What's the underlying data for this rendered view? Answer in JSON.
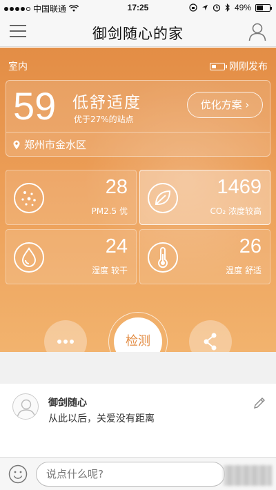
{
  "status_bar": {
    "carrier": "中国联通",
    "time": "17:25",
    "battery_text": "49%",
    "battery_level": 0.49
  },
  "nav": {
    "title": "御剑随心的家",
    "menu_icon": "hamburger-menu-icon",
    "user_icon": "user-profile-icon"
  },
  "main": {
    "section_label": "室内",
    "publish_status": "刚刚发布",
    "score": "59",
    "comfort_level": "低舒适度",
    "better_than": "优于27%的站点",
    "optimize_button": "优化方案",
    "location": "郑州市金水区",
    "accent_color": "#e38d45",
    "metrics": [
      {
        "value": "28",
        "label": "PM2.5 优",
        "icon": "particles-icon"
      },
      {
        "value": "1469",
        "label": "CO₂ 浓度较高",
        "icon": "leaf-icon"
      },
      {
        "value": "24",
        "label": "湿度 较干",
        "icon": "water-drop-icon"
      },
      {
        "value": "26",
        "label": "温度 舒适",
        "icon": "thermometer-icon"
      }
    ],
    "actions": {
      "more_icon": "more-dots-icon",
      "detect_label": "检测",
      "share_icon": "share-icon"
    }
  },
  "post": {
    "author": "御剑随心",
    "text": "从此以后，关爱没有距离"
  },
  "comment": {
    "placeholder": "说点什么呢?"
  }
}
